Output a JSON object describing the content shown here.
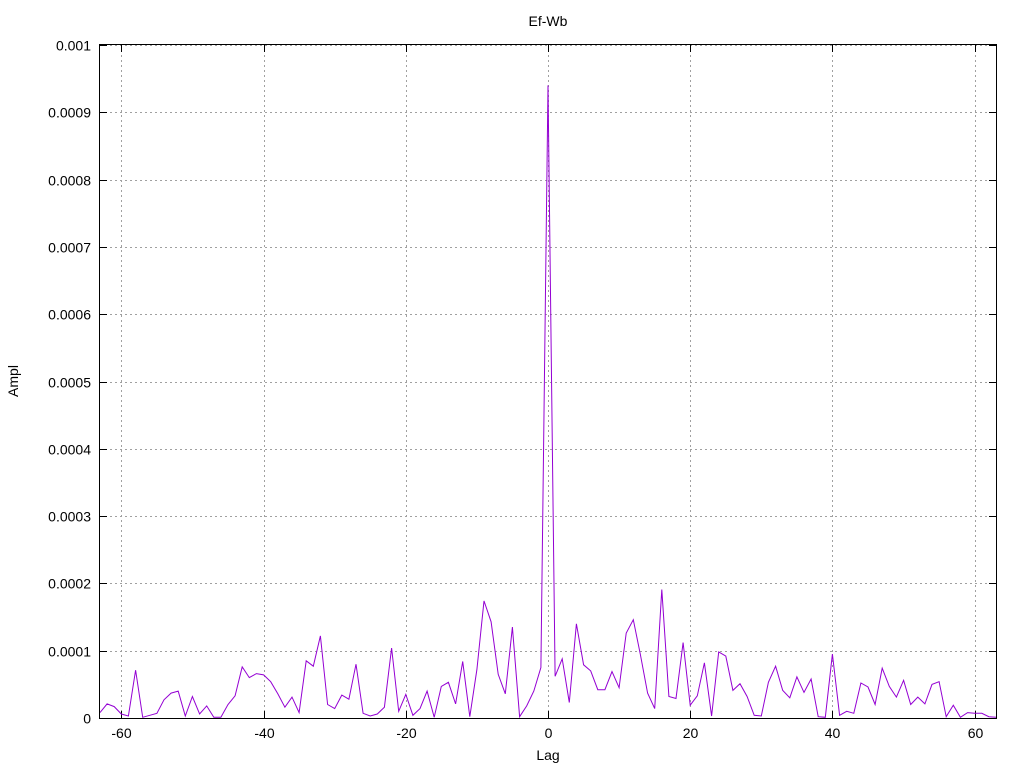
{
  "chart_data": {
    "type": "line",
    "title": "Ef-Wb",
    "xlabel": "Lag",
    "ylabel": "Ampl",
    "xlim": [
      -63,
      63
    ],
    "ylim": [
      0,
      0.001
    ],
    "xticks": [
      -60,
      -40,
      -20,
      0,
      20,
      40,
      60
    ],
    "xtick_labels": [
      "-60",
      "-40",
      "-20",
      "0",
      "20",
      "40",
      "60"
    ],
    "yticks": [
      0,
      0.0001,
      0.0002,
      0.0003,
      0.0004,
      0.0005,
      0.0006,
      0.0007,
      0.0008,
      0.0009,
      0.001
    ],
    "ytick_labels": [
      "0",
      "0.0001",
      "0.0002",
      "0.0003",
      "0.0004",
      "0.0005",
      "0.0006",
      "0.0007",
      "0.0008",
      "0.0009",
      "0.001"
    ],
    "grid": true,
    "series_color": "#9400d3",
    "series": [
      {
        "x": [
          -63,
          -62,
          -61,
          -60,
          -59,
          -58,
          -57,
          -56,
          -55,
          -54,
          -53,
          -52,
          -51,
          -50,
          -49,
          -48,
          -47,
          -46,
          -45,
          -44,
          -43,
          -42,
          -41,
          -40,
          -39,
          -38,
          -37,
          -36,
          -35,
          -34,
          -33,
          -32,
          -31,
          -30,
          -29,
          -28,
          -27,
          -26,
          -25,
          -24,
          -23,
          -22,
          -21,
          -20,
          -19,
          -18,
          -17,
          -16,
          -15,
          -14,
          -13,
          -12,
          -11,
          -10,
          -9,
          -8,
          -7,
          -6,
          -5,
          -4,
          -3,
          -2,
          -1,
          0,
          1,
          2,
          3,
          4,
          5,
          6,
          7,
          8,
          9,
          10,
          11,
          12,
          13,
          14,
          15,
          16,
          17,
          18,
          19,
          20,
          21,
          22,
          23,
          24,
          25,
          26,
          27,
          28,
          29,
          30,
          31,
          32,
          33,
          34,
          35,
          36,
          37,
          38,
          39,
          40,
          41,
          42,
          43,
          44,
          45,
          46,
          47,
          48,
          49,
          50,
          51,
          52,
          53,
          54,
          55,
          56,
          57,
          58,
          59,
          60,
          61,
          62,
          63
        ],
        "y": [
          8e-06,
          2.1e-05,
          1.7e-05,
          6e-06,
          3e-06,
          7.1e-05,
          1e-06,
          4e-06,
          7e-06,
          2.7e-05,
          3.7e-05,
          4e-05,
          3e-06,
          3.2e-05,
          6e-06,
          1.8e-05,
          1e-06,
          1e-06,
          2e-05,
          3.3e-05,
          7.6e-05,
          6e-05,
          6.6e-05,
          6.4e-05,
          5.4e-05,
          3.6e-05,
          1.6e-05,
          3.1e-05,
          8e-06,
          8.5e-05,
          7.7e-05,
          0.000122,
          2e-05,
          1.4e-05,
          3.4e-05,
          2.8e-05,
          8e-05,
          7e-06,
          3e-06,
          6e-06,
          1.6e-05,
          0.000104,
          1e-05,
          3.5e-05,
          4e-06,
          1.4e-05,
          4e-05,
          1e-06,
          4.7e-05,
          5.3e-05,
          2.1e-05,
          8.4e-05,
          2e-06,
          7.2e-05,
          0.000174,
          0.000143,
          6.5e-05,
          3.6e-05,
          0.000135,
          2e-06,
          1.8e-05,
          4e-05,
          7.5e-05,
          0.00094,
          6.2e-05,
          8.8e-05,
          2.3e-05,
          0.00014,
          7.9e-05,
          7e-05,
          4.2e-05,
          4.2e-05,
          6.9e-05,
          4.5e-05,
          0.000126,
          0.000146,
          9.4e-05,
          3.7e-05,
          1.4e-05,
          0.000191,
          3.2e-05,
          2.9e-05,
          0.000112,
          1.9e-05,
          3.3e-05,
          8.2e-05,
          3e-06,
          9.8e-05,
          9.2e-05,
          4.1e-05,
          5.1e-05,
          3.2e-05,
          4e-06,
          3e-06,
          5.3e-05,
          7.7e-05,
          4.1e-05,
          3e-05,
          6.1e-05,
          3.8e-05,
          5.8e-05,
          2e-06,
          1e-06,
          9.5e-05,
          4e-06,
          1e-05,
          7e-06,
          5.2e-05,
          4.6e-05,
          2e-05,
          7.4e-05,
          4.7e-05,
          3.1e-05,
          5.6e-05,
          2e-05,
          3.1e-05,
          2.1e-05,
          5e-05,
          5.4e-05,
          2e-06,
          1.9e-05,
          1e-06,
          8e-06,
          7e-06,
          7e-06,
          2e-06,
          1e-06
        ]
      }
    ]
  }
}
